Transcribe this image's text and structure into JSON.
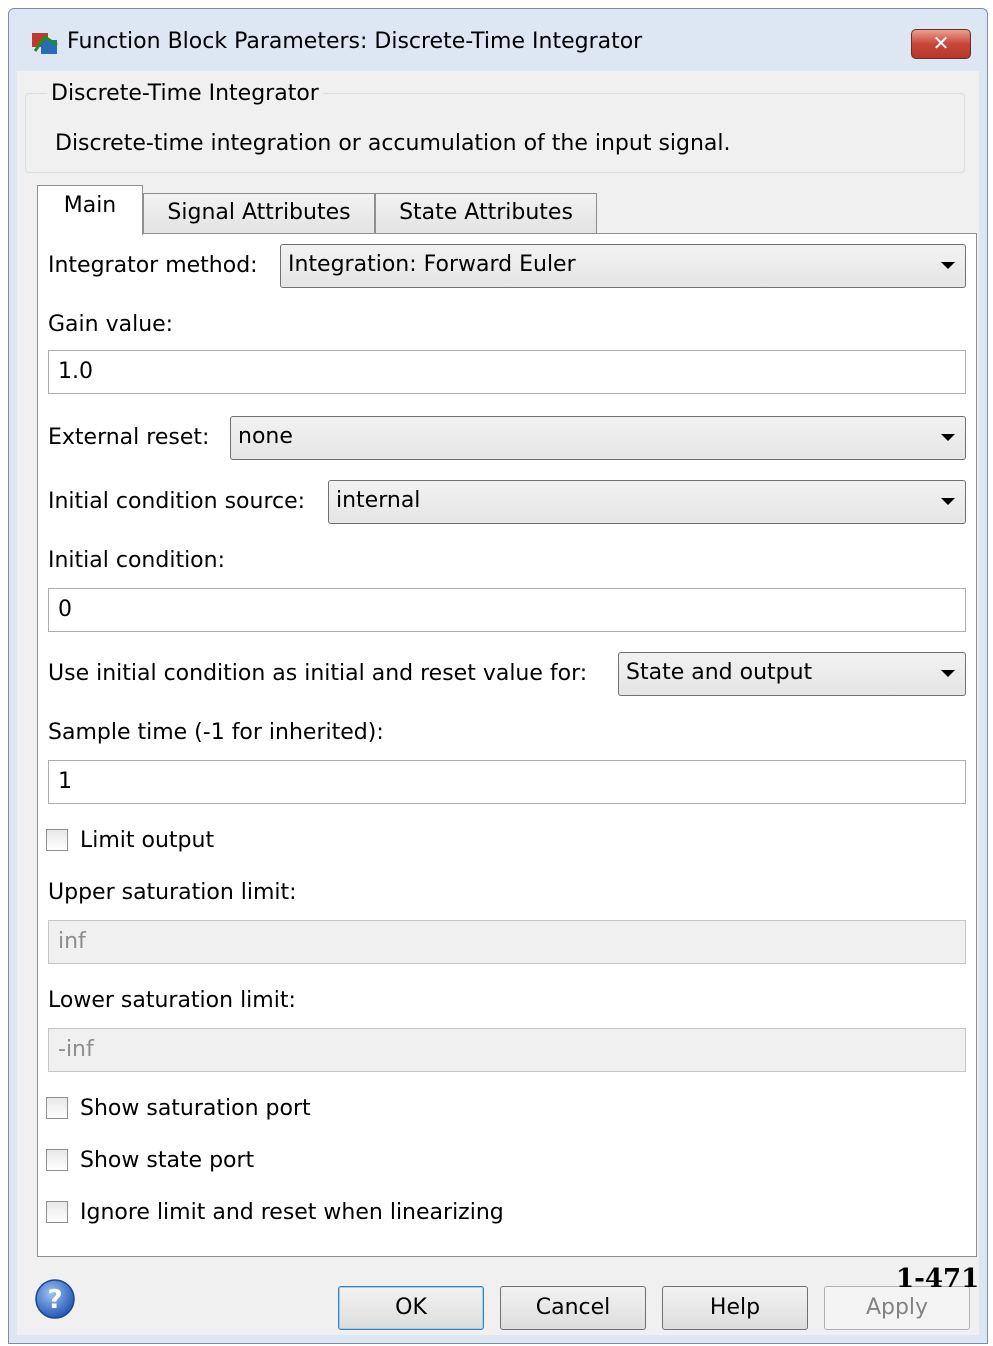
{
  "window": {
    "title": "Function Block Parameters: Discrete-Time Integrator",
    "close_label": "✕",
    "icon": "simulink-block-icon",
    "close_icon": "close-icon"
  },
  "group": {
    "legend": "Discrete-Time Integrator",
    "description": "Discrete-time integration or accumulation of the input signal."
  },
  "tabs": [
    {
      "label": "Main",
      "active": true
    },
    {
      "label": "Signal Attributes",
      "active": false
    },
    {
      "label": "State Attributes",
      "active": false
    }
  ],
  "main": {
    "integrator_method": {
      "label": "Integrator method:",
      "value": "Integration: Forward Euler"
    },
    "gain_value": {
      "label": "Gain value:",
      "value": "1.0"
    },
    "external_reset": {
      "label": "External reset:",
      "value": "none"
    },
    "initial_condition_source": {
      "label": "Initial condition source:",
      "value": "internal"
    },
    "initial_condition": {
      "label": "Initial condition:",
      "value": "0"
    },
    "use_initial_condition": {
      "label": "Use initial condition as initial and reset value for:",
      "value": "State and output"
    },
    "sample_time": {
      "label": "Sample time (-1 for inherited):",
      "value": "1"
    },
    "limit_output": {
      "label": "Limit output",
      "checked": false
    },
    "upper_saturation_limit": {
      "label": "Upper saturation limit:",
      "value": "inf",
      "enabled": false
    },
    "lower_saturation_limit": {
      "label": "Lower saturation limit:",
      "value": "-inf",
      "enabled": false
    },
    "show_saturation_port": {
      "label": "Show saturation port",
      "checked": false
    },
    "show_state_port": {
      "label": "Show state port",
      "checked": false
    },
    "ignore_limit": {
      "label": "Ignore limit and reset when linearizing",
      "checked": false
    }
  },
  "buttons": {
    "ok": "OK",
    "cancel": "Cancel",
    "help": "Help",
    "apply": "Apply"
  },
  "help_icon": "question-mark-icon",
  "page_number": "1-471",
  "colors": {
    "window_frame": "#dce7f3",
    "dialog_background": "#f0f0f0",
    "panel_background": "#ffffff",
    "close_button": "#c9463a",
    "disabled_text": "#8d8d8d"
  }
}
